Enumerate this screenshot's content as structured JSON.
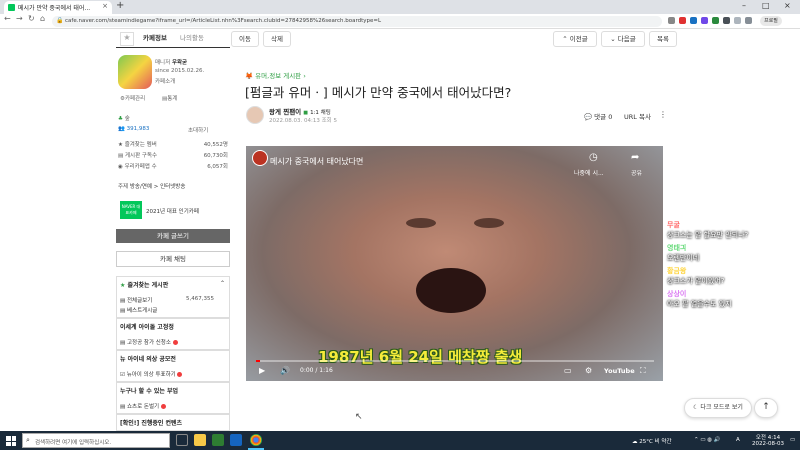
{
  "browser": {
    "tab_title": "메시가 만약 중국에서 태어...",
    "url": "cafe.naver.com/steamindiegame?iframe_url=/ArticleList.nhn%3Fsearch.clubid=27842958%26search.boardtype=L",
    "profile_label": "프로필"
  },
  "sidebar": {
    "tab_cafe_info": "카페정보",
    "tab_my_activity": "나의활동",
    "manager_label": "매니저",
    "manager_name": "우왁굳",
    "since": "since 2015.02.26.",
    "cafe_intro": "카페소개",
    "cafe_manage": "카페관리",
    "stats": "통계",
    "grade": "숲",
    "members": "391,983",
    "invite": "초대하기",
    "fav_board_label": "즐겨찾는 멤버",
    "fav_board_value": "40,552명",
    "subscribers_label": "게시판 구독수",
    "subscribers_value": "60,730회",
    "likes_label": "우리카페앱 수",
    "likes_value": "6,057회",
    "topic_label": "주제",
    "topic_value": "방송/연예 > 인터넷방송",
    "award": "2021년 대표 인기카페",
    "award_badge": "NAVER 대표카페",
    "write_button": "카페 글쓰기",
    "chat_button": "카페 채팅",
    "fav_boards_title": "즐겨찾는 게시판",
    "all_posts": "전체글보기",
    "all_posts_count": "5,467,355",
    "best_posts": "베스트게시글",
    "section2_title": "이세계 아이돌 고정정",
    "section2_item": "고정공 참가 신청소",
    "section3_title": "뉴 아이네 의상 공모전",
    "section3_item": "뉴아이 의상 투표하기",
    "section4_title": "누구나 할 수 있는 부업",
    "section4_item": "쇼츠로 돈벌기",
    "section5_title": "[확인!] 진행중인 컨텐츠"
  },
  "toolbar": {
    "move": "이동",
    "delete": "삭제",
    "prev": "이전글",
    "next": "다음글",
    "list": "목록"
  },
  "article": {
    "board": "유머,정보 게시판",
    "title": "[펌글과 유머ㆍ] 메시가 만약 중국에서 태어났다면?",
    "author": "왕게 찐팬이",
    "badge": "1:1 채팅",
    "meta": "2022.08.03. 04:13 조회 5",
    "comments": "댓글 0",
    "url_copy": "URL 복사"
  },
  "video": {
    "title": "메시가 중국에서 태어났다면",
    "share_label": "공유",
    "watch_later": "나중에 시...",
    "subtitle": "1987년 6월 24일 메착짱 출생",
    "time": "0:00 / 1:16",
    "youtube": "YouTube",
    "progress": 0.01
  },
  "chat": [
    {
      "name": "무굴",
      "msg": "상크스는 말 할요만 안되나?",
      "color": "#ff6b6b"
    },
    {
      "name": "영태긔",
      "msg": "오렌만이네",
      "color": "#69db7c"
    },
    {
      "name": "황금왕",
      "msg": "상크스가 말이있어?",
      "color": "#ffd43b"
    },
    {
      "name": "상상이",
      "msg": "아오 팔 얼을수도 있지",
      "color": "#da77f2"
    }
  ],
  "floating": {
    "dark_mode": "다크 모드로 보기",
    "top": "↑"
  },
  "taskbar": {
    "search_placeholder": "검색하려면 여기에 입력하십시오.",
    "weather": "25°C 비 약간",
    "lang": "A",
    "time": "오전 4:14",
    "date": "2022-08-03"
  }
}
